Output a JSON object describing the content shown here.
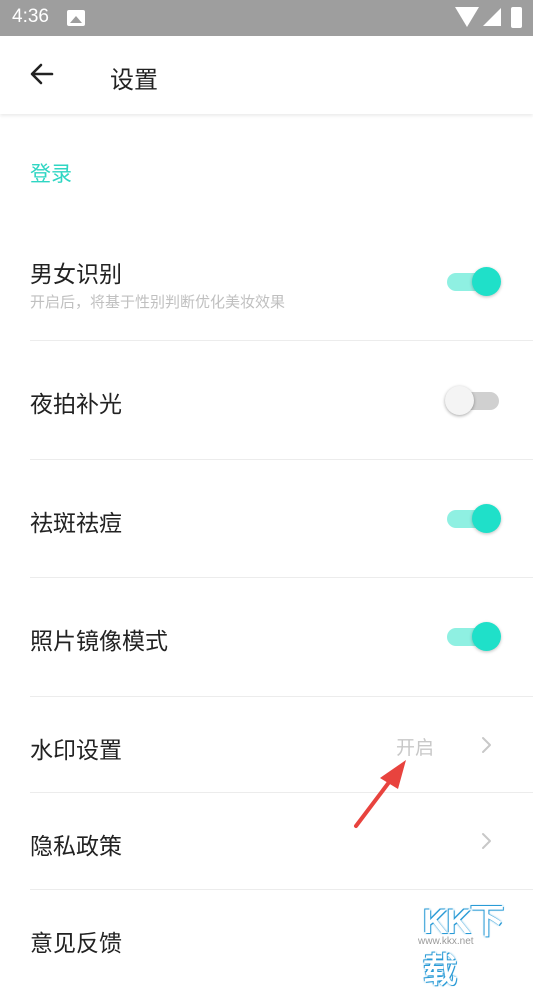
{
  "status_bar": {
    "time": "4:36"
  },
  "app_bar": {
    "title": "设置"
  },
  "sections": [
    {
      "header": "登录"
    }
  ],
  "settings": {
    "gender_detection": {
      "label": "男女识别",
      "subtitle": "开启后，将基于性别判断优化美妆效果",
      "enabled": true
    },
    "night_fill_light": {
      "label": "夜拍补光",
      "enabled": false
    },
    "blemish_removal": {
      "label": "祛斑祛痘",
      "enabled": true
    },
    "mirror_mode": {
      "label": "照片镜像模式",
      "enabled": true
    },
    "watermark": {
      "label": "水印设置",
      "value": "开启"
    },
    "privacy_policy": {
      "label": "隐私政策"
    },
    "feedback": {
      "label": "意见反馈"
    }
  },
  "colors": {
    "accent": "#2fd6c3",
    "toggle_on": "#1fe0c9",
    "annotation_arrow": "#e8433e"
  },
  "watermark_overlay": {
    "brand": "KK下载",
    "url": "www.kkx.net"
  }
}
